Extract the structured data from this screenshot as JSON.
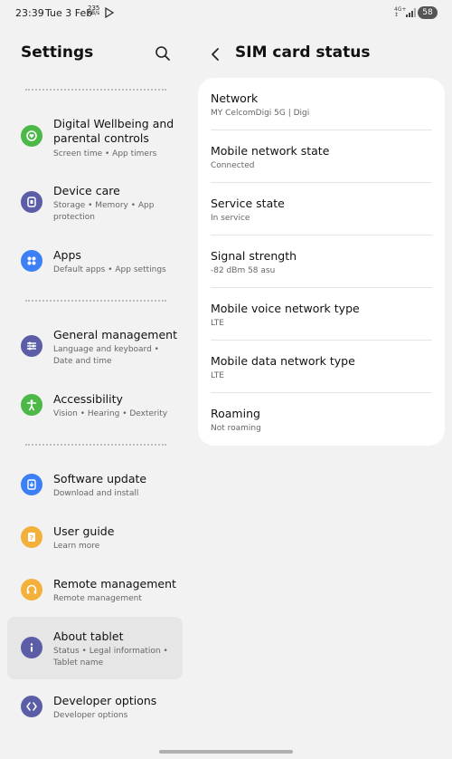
{
  "status_bar": {
    "time": "23:39",
    "date": "Tue 3 Feb",
    "speed_value": "235",
    "speed_unit": "KB/s",
    "battery": "58"
  },
  "left": {
    "title": "Settings",
    "groups": [
      [
        {
          "label": "Digital Wellbeing and parental controls",
          "sub": "Screen time  •  App timers",
          "icon": "digital-wellbeing-icon",
          "color": "#4cb847"
        },
        {
          "label": "Device care",
          "sub": "Storage  •  Memory  •  App protection",
          "icon": "device-care-icon",
          "color": "#5b5ea6"
        },
        {
          "label": "Apps",
          "sub": "Default apps  •  App settings",
          "icon": "apps-icon",
          "color": "#3d7ff5"
        }
      ],
      [
        {
          "label": "General management",
          "sub": "Language and keyboard  •  Date and time",
          "icon": "general-management-icon",
          "color": "#5b5ea6"
        },
        {
          "label": "Accessibility",
          "sub": "Vision  •  Hearing  •  Dexterity",
          "icon": "accessibility-icon",
          "color": "#4cb847"
        }
      ],
      [
        {
          "label": "Software update",
          "sub": "Download and install",
          "icon": "software-update-icon",
          "color": "#3d7ff5"
        },
        {
          "label": "User guide",
          "sub": "Learn more",
          "icon": "user-guide-icon",
          "color": "#f3b13c"
        },
        {
          "label": "Remote management",
          "sub": "Remote management",
          "icon": "remote-management-icon",
          "color": "#f3b13c"
        },
        {
          "label": "About tablet",
          "sub": "Status  •  Legal information  •  Tablet name",
          "icon": "about-tablet-icon",
          "color": "#5b5ea6"
        },
        {
          "label": "Developer options",
          "sub": "Developer options",
          "icon": "developer-options-icon",
          "color": "#5b5ea6"
        }
      ]
    ]
  },
  "right": {
    "title": "SIM card status",
    "rows": [
      {
        "label": "Network",
        "value": "MY CelcomDigi 5G | Digi"
      },
      {
        "label": "Mobile network state",
        "value": "Connected"
      },
      {
        "label": "Service state",
        "value": "In service"
      },
      {
        "label": "Signal strength",
        "value": "-82 dBm 58 asu"
      },
      {
        "label": "Mobile voice network type",
        "value": "LTE"
      },
      {
        "label": "Mobile data network type",
        "value": "LTE"
      },
      {
        "label": "Roaming",
        "value": "Not roaming"
      }
    ]
  }
}
